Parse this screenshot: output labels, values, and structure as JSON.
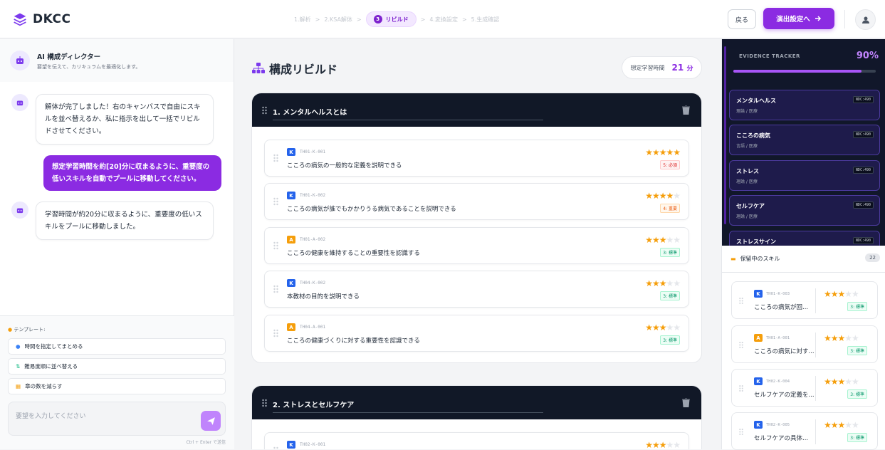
{
  "app": {
    "name": "DKCC"
  },
  "steps": {
    "s1": "1.解析",
    "s2": "2.KSA解体",
    "active_num": "3",
    "active_label": "リビルド",
    "s4": "4.変換設定",
    "s5": "5.生成確認",
    "sep": ">"
  },
  "header": {
    "back_label": "戻る",
    "next_label": "演出設定へ",
    "next_icon": "arrow-right-icon",
    "user_icon": "user-icon"
  },
  "colors": {
    "accent": "#8b2be2",
    "dark": "#111827",
    "star": "#f59e0b"
  },
  "chat": {
    "title": "AI 構成ディレクター",
    "subtitle": "要望を伝えて、カリキュラムを最適化します。",
    "messages": [
      {
        "role": "bot",
        "text": "解体が完了しました！右のキャンバスで自由にスキルを並べ替えるか、私に指示を出して一括でリビルドさせてください。"
      },
      {
        "role": "user",
        "text": "想定学習時間を約[20]分に収まるように、重要度の低いスキルを自動でプールに移動してください。"
      },
      {
        "role": "bot",
        "text": "学習時間が約20分に収まるように、重要度の低いスキルをプールに移動しました。"
      }
    ],
    "template_label": "テンプレート:",
    "templates": [
      {
        "icon": "clock-icon",
        "label": "時間を指定してまとめる"
      },
      {
        "icon": "sort-icon",
        "label": "難易度順に並べ替える"
      },
      {
        "icon": "grid-icon",
        "label": "章の数を減らす"
      }
    ],
    "input_placeholder": "要望を入力してください",
    "hint": "Ctrl + Enter で送信"
  },
  "canvas": {
    "title": "構成リビルド",
    "time_label": "想定学習時間",
    "time_value": "21",
    "time_unit": "分",
    "chapters": [
      {
        "title": "1. メンタルヘルスとは",
        "skills": [
          {
            "type": "K",
            "code": "TH01-K-001",
            "name": "こころの病気の一般的な定義を説明できる",
            "rating": 5,
            "level": "5: 必須"
          },
          {
            "type": "K",
            "code": "TH01-K-002",
            "name": "こころの病気が誰でもかかりうる病気であることを説明できる",
            "rating": 4,
            "level": "4: 重要"
          },
          {
            "type": "A",
            "code": "TH01-A-002",
            "name": "こころの健康を維持することの重要性を認識する",
            "rating": 3,
            "level": "3: 標準"
          },
          {
            "type": "K",
            "code": "TH04-K-002",
            "name": "本教材の目的を説明できる",
            "rating": 3,
            "level": "3: 標準"
          },
          {
            "type": "A",
            "code": "TH04-A-001",
            "name": "こころの健康づくりに対する重要性を認識できる",
            "rating": 3,
            "level": "3: 標準"
          }
        ]
      },
      {
        "title": "2. ストレスとセルフケア",
        "skills": [
          {
            "type": "K",
            "code": "TH02-K-001",
            "name": "",
            "rating": 3,
            "level": ""
          }
        ]
      }
    ]
  },
  "evidence": {
    "title": "EVIDENCE TRACKER",
    "percent": "90%",
    "progress": 0.9,
    "items": [
      {
        "name": "メンタルヘルス",
        "sub": "理論 / 医療",
        "tag": "NDC:490"
      },
      {
        "name": "こころの病気",
        "sub": "言語 / 医療",
        "tag": "NDC:490"
      },
      {
        "name": "ストレス",
        "sub": "理論 / 医療",
        "tag": "NDC:490"
      },
      {
        "name": "セルフケア",
        "sub": "理論 / 医療",
        "tag": "NDC:490"
      },
      {
        "name": "ストレスサイン",
        "sub": "",
        "tag": "NDC:490"
      }
    ]
  },
  "pool": {
    "title": "保留中のスキル",
    "count": "22",
    "items": [
      {
        "type": "K",
        "code": "TH01-K-003",
        "name": "こころの病気が回...",
        "rating": 3,
        "level": "3: 標準"
      },
      {
        "type": "A",
        "code": "TH01-A-001",
        "name": "こころの病気に対す...",
        "rating": 3,
        "level": "3: 標準"
      },
      {
        "type": "K",
        "code": "TH02-K-004",
        "name": "セルフケアの定義を...",
        "rating": 3,
        "level": "3: 標準"
      },
      {
        "type": "K",
        "code": "TH02-K-005",
        "name": "セルフケアの具体...",
        "rating": 3,
        "level": "3: 標準"
      }
    ]
  }
}
